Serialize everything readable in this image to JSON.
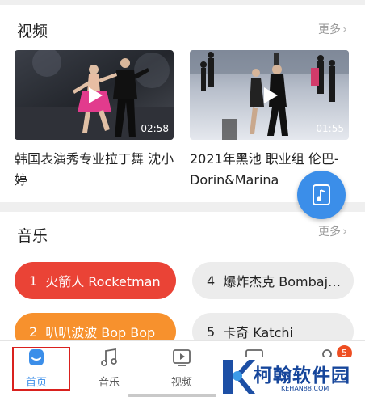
{
  "videos_section": {
    "title": "视频",
    "more": "更多",
    "items": [
      {
        "title": "韩国表演秀专业拉丁舞 沈小婷",
        "duration": "02:58"
      },
      {
        "title": "2021年黑池 职业组 伦巴-Dorin&Marina",
        "duration": "01:55"
      }
    ]
  },
  "music_section": {
    "title": "音乐",
    "more": "更多",
    "items": [
      {
        "index": "1",
        "title": "火箭人 Rocketman",
        "color": "#ea4336"
      },
      {
        "index": "4",
        "title": "爆炸杰克 Bombaj…",
        "color": "#ececec"
      },
      {
        "index": "2",
        "title": "叭叭波波 Bop Bop",
        "color": "#f7912d"
      },
      {
        "index": "5",
        "title": "卡奇 Katchi",
        "color": "#ececec"
      }
    ]
  },
  "tabbar": {
    "tabs": [
      {
        "label": "首页",
        "icon": "home-icon",
        "active": true
      },
      {
        "label": "音乐",
        "icon": "music-note-icon",
        "active": false
      },
      {
        "label": "视频",
        "icon": "video-play-icon",
        "active": false
      },
      {
        "label": "",
        "icon": "film-icon",
        "active": false
      },
      {
        "label": "",
        "icon": "profile-icon",
        "active": false
      }
    ],
    "badge_count": "5"
  },
  "floating_button": {
    "icon": "music-player-icon"
  },
  "watermark": {
    "text": "柯翰软件园",
    "sub": "KEHAN88.COM"
  },
  "colors": {
    "accent": "#3b8ee9",
    "highlight_box": "#d9211e",
    "badge": "#ee4e22"
  }
}
